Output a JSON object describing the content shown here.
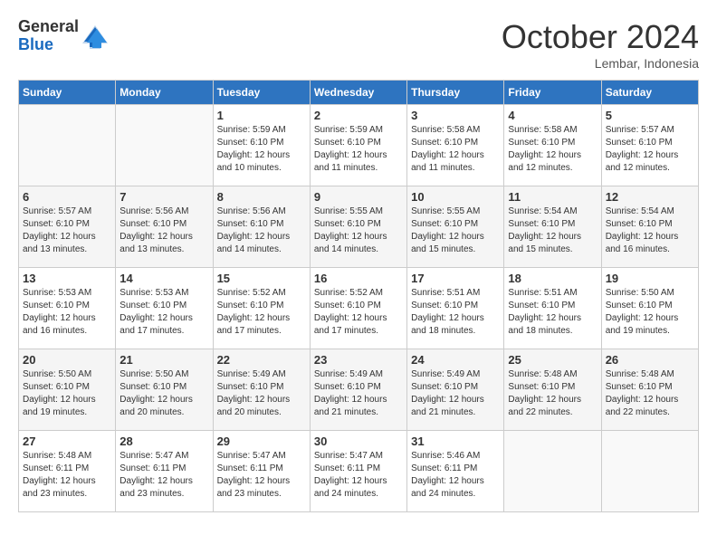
{
  "header": {
    "logo_general": "General",
    "logo_blue": "Blue",
    "month_year": "October 2024",
    "location": "Lembar, Indonesia"
  },
  "days_of_week": [
    "Sunday",
    "Monday",
    "Tuesday",
    "Wednesday",
    "Thursday",
    "Friday",
    "Saturday"
  ],
  "weeks": [
    [
      {
        "day": "",
        "info": ""
      },
      {
        "day": "",
        "info": ""
      },
      {
        "day": "1",
        "info": "Sunrise: 5:59 AM\nSunset: 6:10 PM\nDaylight: 12 hours and 10 minutes."
      },
      {
        "day": "2",
        "info": "Sunrise: 5:59 AM\nSunset: 6:10 PM\nDaylight: 12 hours and 11 minutes."
      },
      {
        "day": "3",
        "info": "Sunrise: 5:58 AM\nSunset: 6:10 PM\nDaylight: 12 hours and 11 minutes."
      },
      {
        "day": "4",
        "info": "Sunrise: 5:58 AM\nSunset: 6:10 PM\nDaylight: 12 hours and 12 minutes."
      },
      {
        "day": "5",
        "info": "Sunrise: 5:57 AM\nSunset: 6:10 PM\nDaylight: 12 hours and 12 minutes."
      }
    ],
    [
      {
        "day": "6",
        "info": "Sunrise: 5:57 AM\nSunset: 6:10 PM\nDaylight: 12 hours and 13 minutes."
      },
      {
        "day": "7",
        "info": "Sunrise: 5:56 AM\nSunset: 6:10 PM\nDaylight: 12 hours and 13 minutes."
      },
      {
        "day": "8",
        "info": "Sunrise: 5:56 AM\nSunset: 6:10 PM\nDaylight: 12 hours and 14 minutes."
      },
      {
        "day": "9",
        "info": "Sunrise: 5:55 AM\nSunset: 6:10 PM\nDaylight: 12 hours and 14 minutes."
      },
      {
        "day": "10",
        "info": "Sunrise: 5:55 AM\nSunset: 6:10 PM\nDaylight: 12 hours and 15 minutes."
      },
      {
        "day": "11",
        "info": "Sunrise: 5:54 AM\nSunset: 6:10 PM\nDaylight: 12 hours and 15 minutes."
      },
      {
        "day": "12",
        "info": "Sunrise: 5:54 AM\nSunset: 6:10 PM\nDaylight: 12 hours and 16 minutes."
      }
    ],
    [
      {
        "day": "13",
        "info": "Sunrise: 5:53 AM\nSunset: 6:10 PM\nDaylight: 12 hours and 16 minutes."
      },
      {
        "day": "14",
        "info": "Sunrise: 5:53 AM\nSunset: 6:10 PM\nDaylight: 12 hours and 17 minutes."
      },
      {
        "day": "15",
        "info": "Sunrise: 5:52 AM\nSunset: 6:10 PM\nDaylight: 12 hours and 17 minutes."
      },
      {
        "day": "16",
        "info": "Sunrise: 5:52 AM\nSunset: 6:10 PM\nDaylight: 12 hours and 17 minutes."
      },
      {
        "day": "17",
        "info": "Sunrise: 5:51 AM\nSunset: 6:10 PM\nDaylight: 12 hours and 18 minutes."
      },
      {
        "day": "18",
        "info": "Sunrise: 5:51 AM\nSunset: 6:10 PM\nDaylight: 12 hours and 18 minutes."
      },
      {
        "day": "19",
        "info": "Sunrise: 5:50 AM\nSunset: 6:10 PM\nDaylight: 12 hours and 19 minutes."
      }
    ],
    [
      {
        "day": "20",
        "info": "Sunrise: 5:50 AM\nSunset: 6:10 PM\nDaylight: 12 hours and 19 minutes."
      },
      {
        "day": "21",
        "info": "Sunrise: 5:50 AM\nSunset: 6:10 PM\nDaylight: 12 hours and 20 minutes."
      },
      {
        "day": "22",
        "info": "Sunrise: 5:49 AM\nSunset: 6:10 PM\nDaylight: 12 hours and 20 minutes."
      },
      {
        "day": "23",
        "info": "Sunrise: 5:49 AM\nSunset: 6:10 PM\nDaylight: 12 hours and 21 minutes."
      },
      {
        "day": "24",
        "info": "Sunrise: 5:49 AM\nSunset: 6:10 PM\nDaylight: 12 hours and 21 minutes."
      },
      {
        "day": "25",
        "info": "Sunrise: 5:48 AM\nSunset: 6:10 PM\nDaylight: 12 hours and 22 minutes."
      },
      {
        "day": "26",
        "info": "Sunrise: 5:48 AM\nSunset: 6:10 PM\nDaylight: 12 hours and 22 minutes."
      }
    ],
    [
      {
        "day": "27",
        "info": "Sunrise: 5:48 AM\nSunset: 6:11 PM\nDaylight: 12 hours and 23 minutes."
      },
      {
        "day": "28",
        "info": "Sunrise: 5:47 AM\nSunset: 6:11 PM\nDaylight: 12 hours and 23 minutes."
      },
      {
        "day": "29",
        "info": "Sunrise: 5:47 AM\nSunset: 6:11 PM\nDaylight: 12 hours and 23 minutes."
      },
      {
        "day": "30",
        "info": "Sunrise: 5:47 AM\nSunset: 6:11 PM\nDaylight: 12 hours and 24 minutes."
      },
      {
        "day": "31",
        "info": "Sunrise: 5:46 AM\nSunset: 6:11 PM\nDaylight: 12 hours and 24 minutes."
      },
      {
        "day": "",
        "info": ""
      },
      {
        "day": "",
        "info": ""
      }
    ]
  ]
}
